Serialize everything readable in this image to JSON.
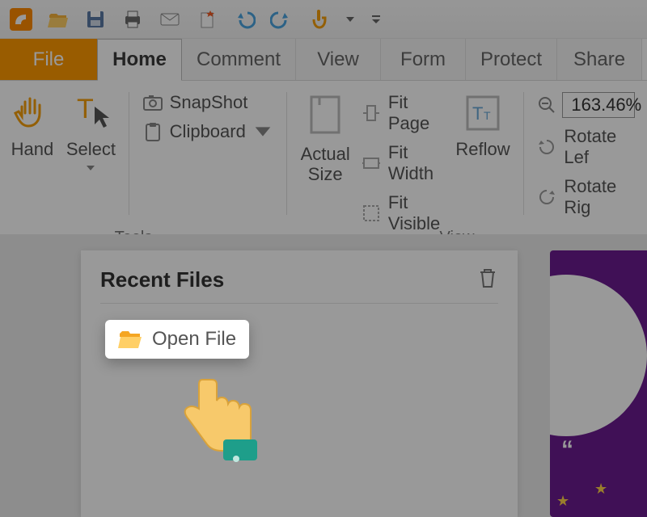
{
  "qat": {
    "icons": [
      "app",
      "open",
      "save",
      "print",
      "email",
      "new-star",
      "undo",
      "redo",
      "touch-mode",
      "dropdown",
      "customize"
    ]
  },
  "tabs": {
    "file": "File",
    "items": [
      "Home",
      "Comment",
      "View",
      "Form",
      "Protect",
      "Share"
    ],
    "active": "Home"
  },
  "ribbon": {
    "tools": {
      "hand": "Hand",
      "select": "Select",
      "snapshot": "SnapShot",
      "clipboard": "Clipboard",
      "group_label": "Tools"
    },
    "view": {
      "actual_size": "Actual\nSize",
      "fit_page": "Fit Page",
      "fit_width": "Fit Width",
      "fit_visible": "Fit Visible",
      "reflow": "Reflow",
      "zoom_value": "163.46%",
      "rotate_left": "Rotate Lef",
      "rotate_right": "Rotate Rig",
      "group_label": "View"
    }
  },
  "panel": {
    "title": "Recent Files",
    "open_file": "Open File"
  }
}
